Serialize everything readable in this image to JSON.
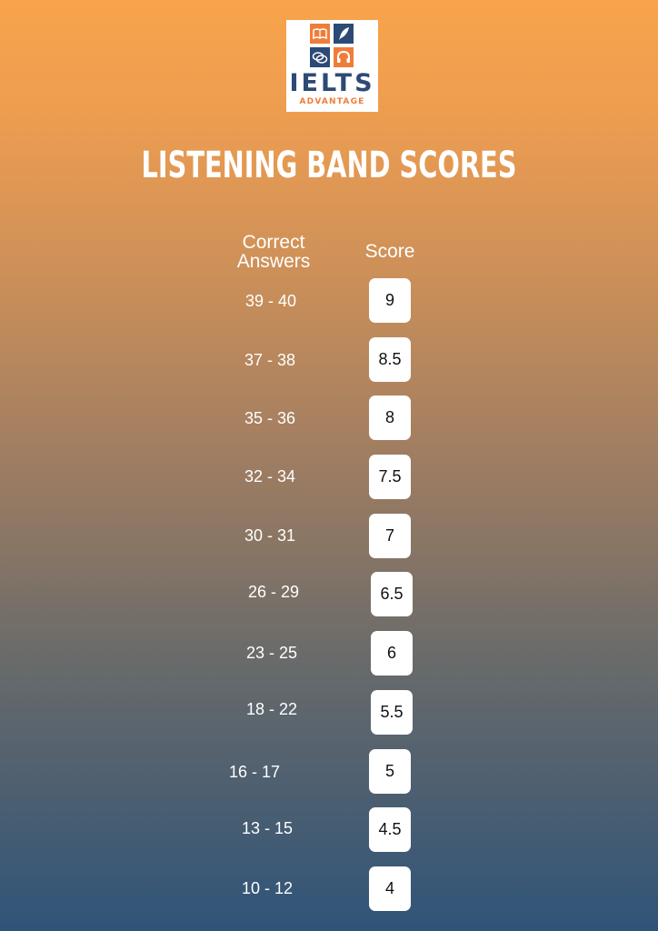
{
  "logo": {
    "icons": [
      "book-icon",
      "quill-icon",
      "speech-bubbles-icon",
      "headphones-icon"
    ],
    "word": "IELTS",
    "sub": "ADVANTAGE",
    "colors": {
      "navy": "#2c4a75",
      "orange": "#ef7d3a"
    }
  },
  "title": "LISTENING BAND SCORES",
  "table": {
    "header_answers": "Correct Answers",
    "header_score": "Score",
    "rows": [
      {
        "range": "39 - 40",
        "score": "9"
      },
      {
        "range": "37 - 38",
        "score": "8.5"
      },
      {
        "range": "35 - 36",
        "score": "8"
      },
      {
        "range": "32 - 34",
        "score": "7.5"
      },
      {
        "range": "30 - 31",
        "score": "7"
      },
      {
        "range": "26 - 29",
        "score": "6.5"
      },
      {
        "range": "23 - 25",
        "score": "6"
      },
      {
        "range": "18 - 22",
        "score": "5.5"
      },
      {
        "range": "16 - 17",
        "score": "5"
      },
      {
        "range": "13 - 15",
        "score": "4.5"
      },
      {
        "range": "10 - 12",
        "score": "4"
      }
    ]
  },
  "colors": {
    "gradient_top": "#f8a44c",
    "gradient_bottom": "#2f5479"
  }
}
